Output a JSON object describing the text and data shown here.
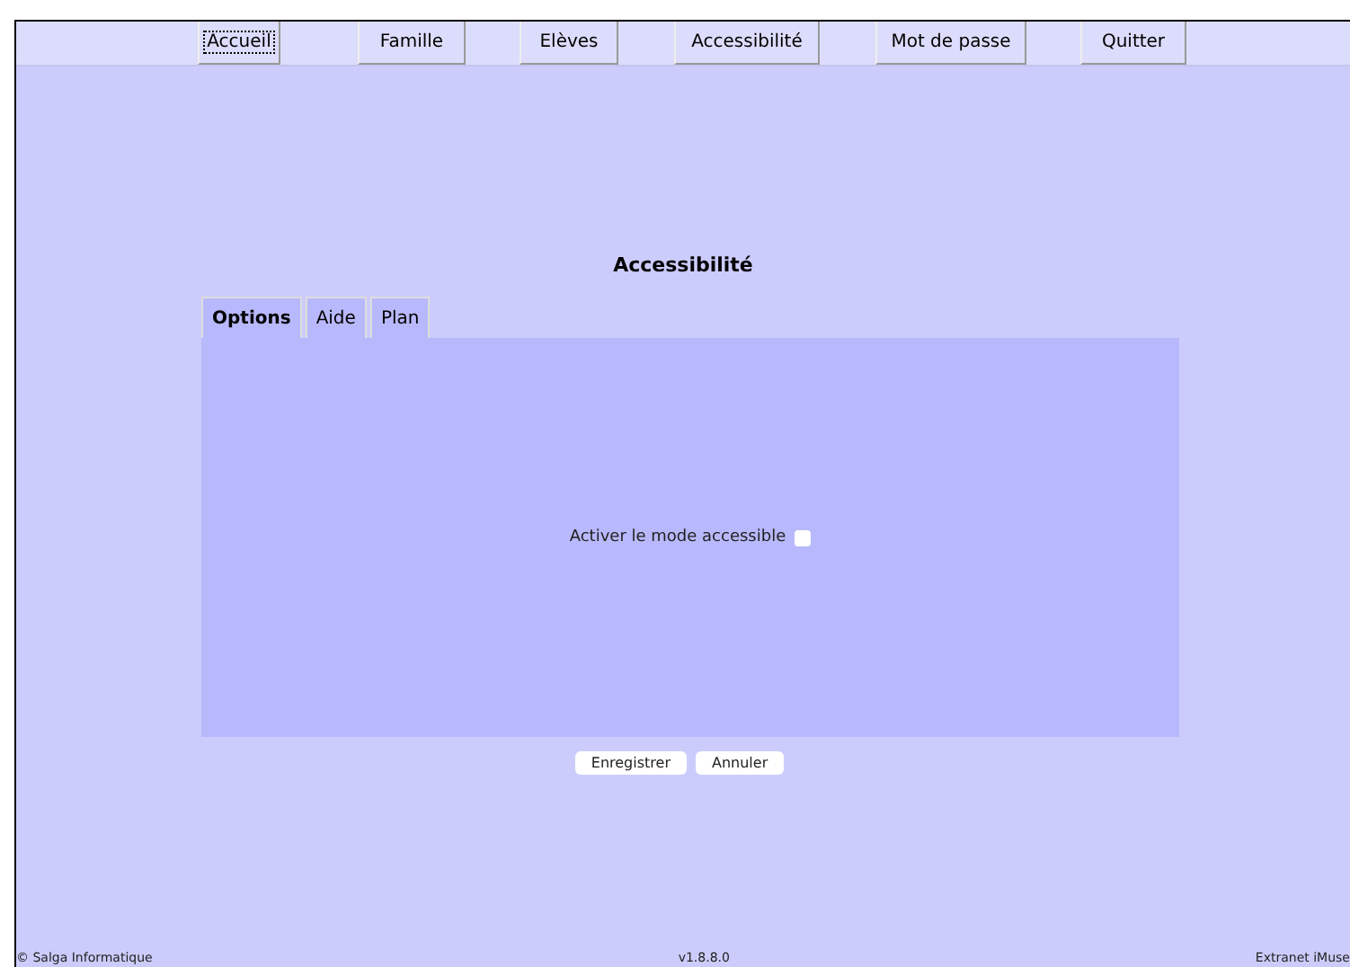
{
  "nav": [
    {
      "label": "Accueil",
      "focused": true
    },
    {
      "label": "Famille",
      "focused": false
    },
    {
      "label": "Elèves",
      "focused": false
    },
    {
      "label": "Accessibilité",
      "focused": false
    },
    {
      "label": "Mot de passe",
      "focused": false
    },
    {
      "label": "Quitter",
      "focused": false
    }
  ],
  "title": "Accessibilité",
  "tabs": [
    {
      "label": "Options",
      "selected": true
    },
    {
      "label": "Aide",
      "selected": false
    },
    {
      "label": "Plan",
      "selected": false
    }
  ],
  "option": {
    "label": "Activer le mode accessible",
    "checked": false
  },
  "buttons": [
    "Enregistrer",
    "Annuler"
  ],
  "footer": {
    "left": "© Salga Informatique",
    "center": "v1.8.8.0",
    "right": "Extranet iMuse"
  }
}
